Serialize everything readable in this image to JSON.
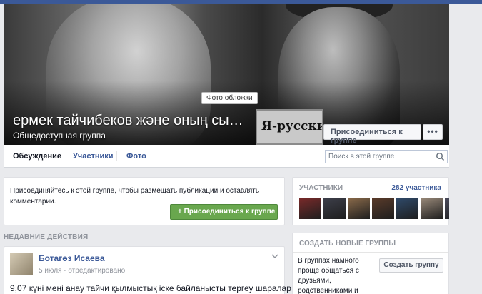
{
  "cover": {
    "tooltip": "Фото обложки",
    "title": "ермек тайчибеков және оның сы…",
    "subtitle": "Общедоступная группа",
    "sign_text": "Я-русский",
    "join_button": "Присоединиться к группе",
    "more_button": "•••"
  },
  "nav": {
    "tabs": [
      "Обсуждение",
      "Участники",
      "Фото"
    ],
    "active": "Обсуждение",
    "search_placeholder": "Поиск в этой группе"
  },
  "join_panel": {
    "text": "Присоединяйтесь к этой группе, чтобы размещать публикации и оставлять комментарии.",
    "button": "+ Присоединиться к группе"
  },
  "recent": {
    "label": "НЕДАВНИЕ ДЕЙСТВИЯ"
  },
  "post": {
    "author": "Ботагөз Исаева",
    "meta": "5 июля · отредактировано",
    "text": "9,07 күні мені анау тайчи қылмыстық іске байланысты тергеу шаралар"
  },
  "members": {
    "label": "УЧАСТНИКИ",
    "count": "282 участника",
    "thumbs": [
      "#7a2a2a",
      "#3d3f4a",
      "#8a6a4a",
      "#5a3b2a",
      "#2f4a6a",
      "#9a8a7a",
      "#4a4a5a"
    ]
  },
  "create_groups": {
    "label": "СОЗДАТЬ НОВЫЕ ГРУППЫ",
    "desc": "В группах намного проще общаться с друзьями, родственниками и",
    "button": "Создать группу"
  },
  "colors": {
    "facebook_blue": "#3b5998",
    "green": "#69a74e",
    "background": "#e9eaed"
  }
}
